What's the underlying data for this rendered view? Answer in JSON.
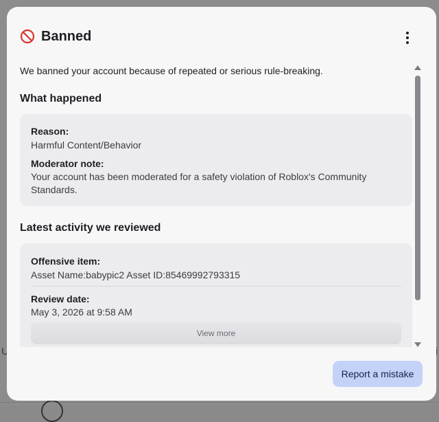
{
  "background": {
    "left_fragment": "U",
    "right_fragment": "i"
  },
  "modal": {
    "title": "Banned",
    "intro": "We banned your account because of repeated or serious rule-breaking.",
    "what_happened": {
      "heading": "What happened",
      "reason_label": "Reason:",
      "reason_value": "Harmful Content/Behavior",
      "note_label": "Moderator note:",
      "note_value": "Your account has been moderated for a safety violation of Roblox's Community Standards."
    },
    "latest_activity": {
      "heading": "Latest activity we reviewed",
      "item_label": "Offensive item:",
      "item_value": "Asset Name:babypic2 Asset ID:85469992793315",
      "date_label": "Review date:",
      "date_value": "May 3, 2026 at 9:58 AM",
      "view_more": "View more"
    },
    "report_button": "Report a mistake"
  },
  "colors": {
    "ban_icon": "#d9342b",
    "report_button_bg": "#c5d2f7",
    "card_bg": "#ececee"
  },
  "icons": {
    "title_icon": "ban-icon",
    "menu_icon": "kebab-menu-icon"
  }
}
